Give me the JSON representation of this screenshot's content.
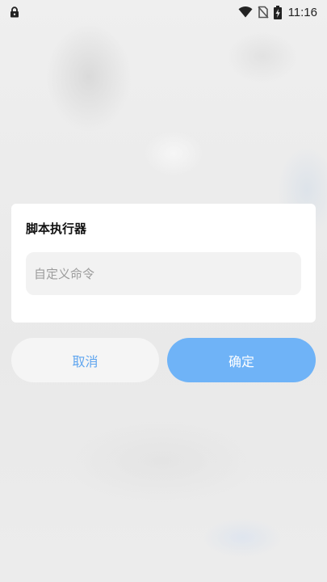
{
  "status_bar": {
    "time": "11:16",
    "icons": [
      "lock-icon",
      "wifi-icon",
      "no-sim-icon",
      "battery-charging-icon"
    ]
  },
  "dialog": {
    "title": "脚本执行器",
    "input": {
      "value": "",
      "placeholder": "自定义命令"
    }
  },
  "buttons": {
    "cancel_label": "取消",
    "confirm_label": "确定"
  },
  "colors": {
    "accent": "#6fb3f7",
    "cancel_text": "#5fa5ef",
    "dialog_bg": "#ffffff",
    "input_bg": "#f2f2f2"
  }
}
